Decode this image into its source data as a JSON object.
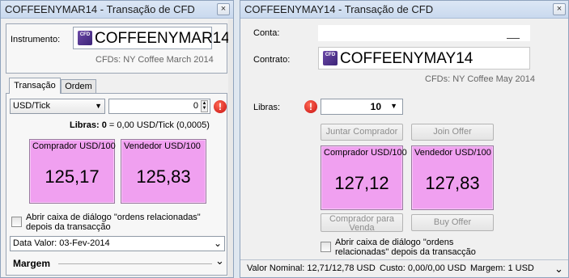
{
  "window1": {
    "title": "COFFEENYMAR14 - Transação de CFD",
    "close": "×",
    "instrument_label": "Instrumento:",
    "instrument_name": "COFFEENYMAR14",
    "cfd_icon_text": "CFD",
    "instrument_desc": "CFDs: NY Coffee March 2014",
    "tabs": [
      {
        "label": "Transação"
      },
      {
        "label": "Ordem"
      }
    ],
    "unit_select": "USD/Tick",
    "amount_value": "0",
    "libras_label": "Libras: 0",
    "libras_detail": " = 0,00 USD/Tick (0,0005)",
    "buyer": {
      "label": "Comprador",
      "unit": "USD/100",
      "price": "125,17"
    },
    "seller": {
      "label": "Vendedor",
      "unit": "USD/100",
      "price": "125,83"
    },
    "checkbox_label": "Abrir caixa de diálogo \"ordens relacionadas\" depois da transacção",
    "value_date": "Data Valor: 03-Fev-2014",
    "margin_label": "Margem"
  },
  "window2": {
    "title": "COFFEENYMAY14 - Transação de CFD",
    "close": "×",
    "account_label": "Conta:",
    "contract_label": "Contrato:",
    "instrument_name": "COFFEENYMAY14",
    "cfd_icon_text": "CFD",
    "instrument_desc": "CFDs: NY Coffee May 2014",
    "libras_label": "Libras:",
    "libras_value": "10",
    "join_buyer": "Juntar Comprador",
    "join_offer": "Join Offer",
    "buyer": {
      "label": "Comprador",
      "unit": "USD/100",
      "price": "127,12"
    },
    "seller": {
      "label": "Vendedor",
      "unit": "USD/100",
      "price": "127,83"
    },
    "buyer_to_sell": "Comprador para Venda",
    "buy_offer": "Buy Offer",
    "checkbox_label": "Abrir caixa de diálogo \"ordens relacionadas\" depois da transacção",
    "status": {
      "nominal": "Valor Nominal: 12,71/12,78 USD",
      "cost": "Custo: 0,00/0,00 USD",
      "margin": "Margem: 1 USD"
    }
  },
  "colors": {
    "price_box": "#f0a0f0",
    "warning": "#d01010"
  },
  "icons": [
    "close-icon",
    "cfd-icon",
    "warning-icon",
    "dropdown-arrow-icon",
    "expand-icon",
    "collapse-icon"
  ]
}
